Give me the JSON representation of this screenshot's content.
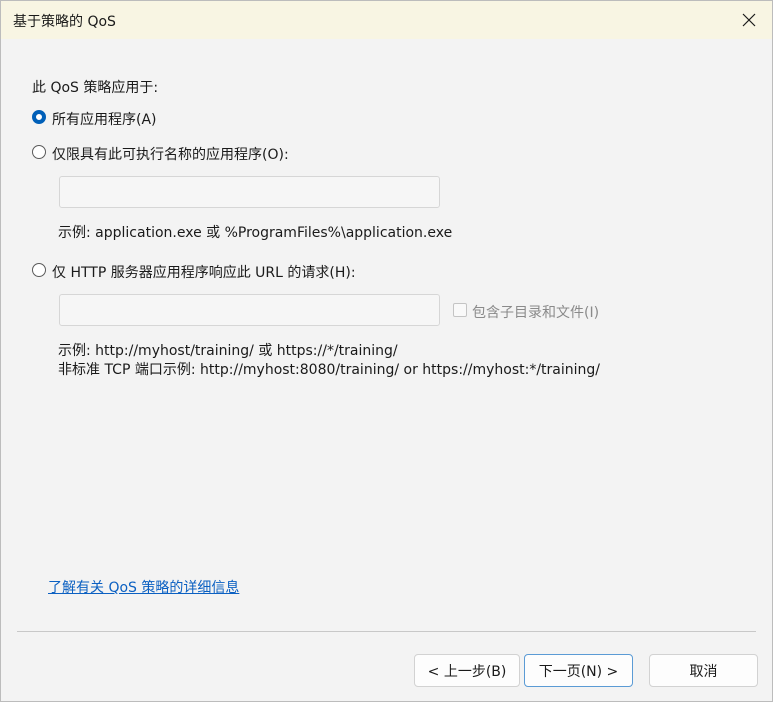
{
  "window": {
    "title": "基于策略的 QoS"
  },
  "section_label": "此 QoS 策略应用于:",
  "options": [
    {
      "label": "所有应用程序(A)",
      "checked": true
    },
    {
      "label": "仅限具有此可执行名称的应用程序(O):",
      "checked": false
    },
    {
      "label": "仅 HTTP 服务器应用程序响应此 URL 的请求(H):",
      "checked": false
    }
  ],
  "exe_input": {
    "value": ""
  },
  "exe_example": "示例:  application.exe 或 %ProgramFiles%\\application.exe",
  "url_input": {
    "value": ""
  },
  "include_subdirs": {
    "label": "包含子目录和文件(I)",
    "checked": false
  },
  "url_example_1": "示例:  http://myhost/training/ 或 https://*/training/",
  "url_example_2": "非标准 TCP 端口示例:  http://myhost:8080/training/ or https://myhost:*/training/",
  "learn_more_link": "了解有关 QoS 策略的详细信息",
  "buttons": {
    "back": "< 上一步(B)",
    "next": "下一页(N) >",
    "cancel": "取消"
  }
}
